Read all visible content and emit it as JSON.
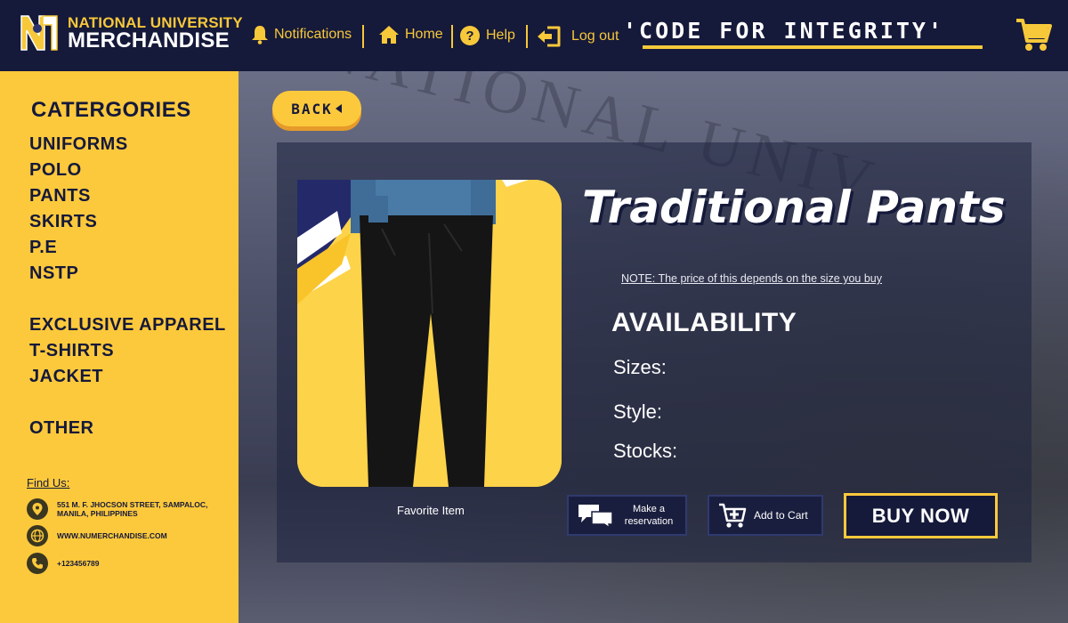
{
  "header": {
    "brand_line1": "NATIONAL UNIVERSITY",
    "brand_line2": "MERCHANDISE",
    "nav": {
      "notifications": "Notifications",
      "home": "Home",
      "help": "Help",
      "logout": "Log out"
    },
    "slogan": "'CODE FOR INTEGRITY'"
  },
  "sidebar": {
    "title": "CATERGORIES",
    "group1": [
      "UNIFORMS",
      "POLO",
      "PANTS",
      "SKIRTS",
      "P.E",
      "NSTP"
    ],
    "group2": [
      "EXCLUSIVE APPAREL",
      "T-SHIRTS",
      "JACKET"
    ],
    "group3": [
      "OTHER"
    ],
    "find_us": "Find Us:",
    "contacts": {
      "address": "551 M. F. JHOCSON STREET, SAMPALOC, MANILA, PHILIPPINES",
      "website": "WWW.NUMERCHANDISE.COM",
      "phone": "+123456789"
    }
  },
  "main": {
    "back_label": "BACK",
    "background_text": "NATIONAL UNIV",
    "product": {
      "title": "Traditional Pants",
      "price_note": "NOTE: The price of this depends on the size you buy",
      "availability_title": "AVAILABILITY",
      "sizes_label": "Sizes:",
      "style_label": "Style:",
      "stocks_label": "Stocks:",
      "favorite_label": "Favorite Item"
    },
    "actions": {
      "reservation_label": "Make a reservation",
      "add_to_cart_label": "Add to Cart",
      "buy_now_label": "BUY NOW"
    }
  },
  "colors": {
    "navy": "#15193a",
    "yellow": "#fdc93c",
    "orange_shadow": "#e59a2a"
  }
}
